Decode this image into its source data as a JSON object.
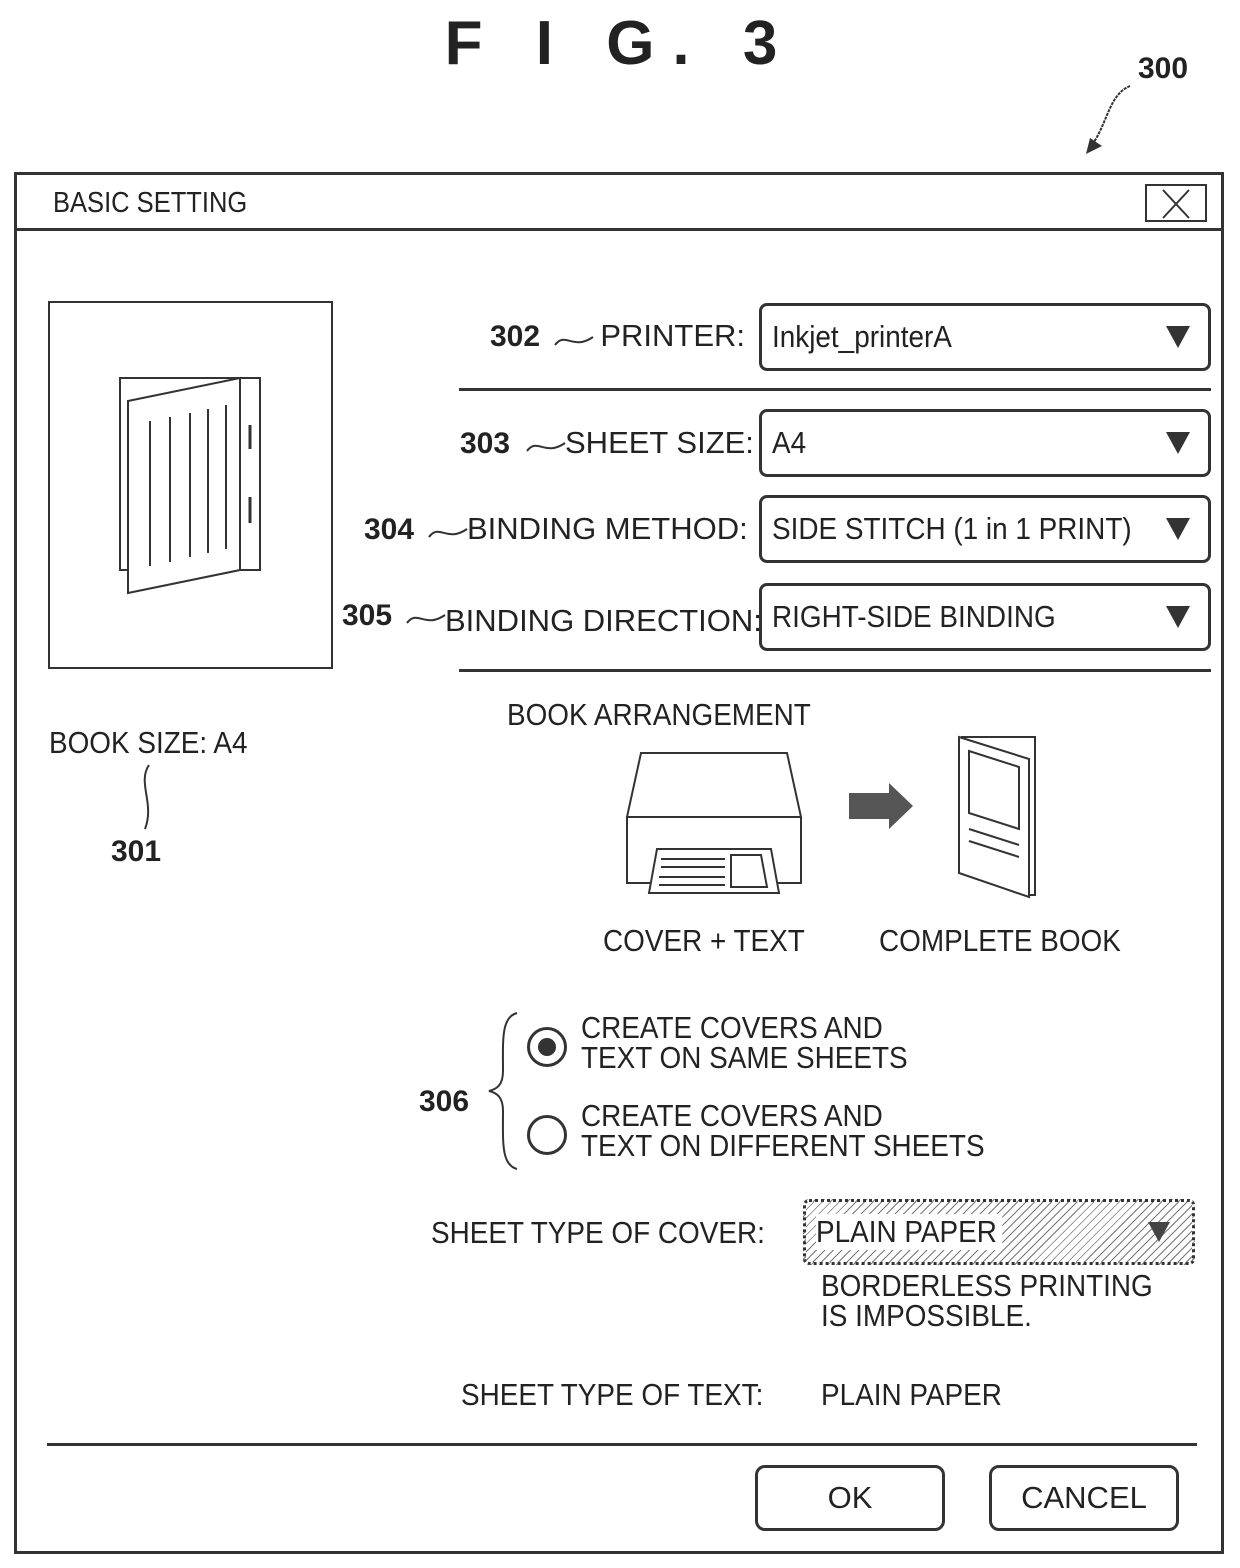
{
  "figure": {
    "title": "F I G.  3",
    "ref_dialog": "300"
  },
  "dialog": {
    "title": "BASIC SETTING",
    "close_icon": "close-icon",
    "preview": {
      "icon": "book-preview-icon",
      "book_size_label": "BOOK SIZE: A4",
      "ref": "301"
    },
    "fields": [
      {
        "ref": "302",
        "label": "PRINTER:",
        "value": "Inkjet_printerA"
      },
      {
        "ref": "303",
        "label": "SHEET SIZE:",
        "value": "A4"
      },
      {
        "ref": "304",
        "label": "BINDING METHOD:",
        "value": "SIDE STITCH (1 in 1 PRINT)"
      },
      {
        "ref": "305",
        "label": "BINDING DIRECTION:",
        "value": "RIGHT-SIDE BINDING"
      }
    ],
    "arrangement": {
      "heading": "BOOK ARRANGEMENT",
      "left_caption": "COVER + TEXT",
      "right_caption": "COMPLETE BOOK",
      "left_icon": "printer-icon",
      "arrow_icon": "arrow-right-icon",
      "right_icon": "complete-book-icon"
    },
    "cover_options": {
      "ref": "306",
      "options": [
        {
          "line1": "CREATE COVERS AND",
          "line2": "TEXT ON SAME SHEETS",
          "selected": true
        },
        {
          "line1": "CREATE COVERS AND",
          "line2": "TEXT ON DIFFERENT SHEETS",
          "selected": false
        }
      ]
    },
    "sheet_type_cover": {
      "label": "SHEET TYPE OF COVER:",
      "value": "PLAIN PAPER",
      "disabled": true,
      "warning_line1": "BORDERLESS PRINTING",
      "warning_line2": "IS IMPOSSIBLE."
    },
    "sheet_type_text": {
      "label": "SHEET TYPE OF TEXT:",
      "value": "PLAIN PAPER"
    },
    "buttons": {
      "ok": "OK",
      "cancel": "CANCEL"
    }
  }
}
